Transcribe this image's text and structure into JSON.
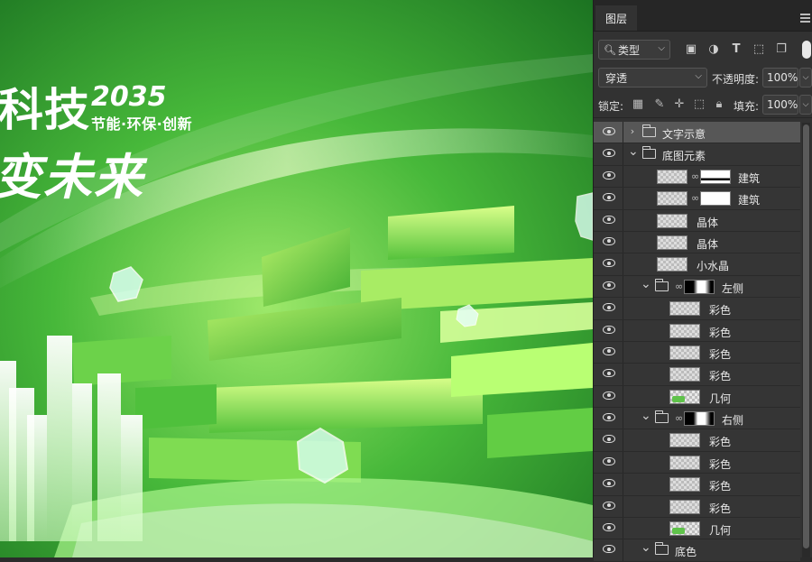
{
  "canvas": {
    "title_line1": "科技",
    "year": "2035",
    "slogan": "节能·环保·创新",
    "title_line2": "变未来"
  },
  "panel": {
    "tab_label": "图层",
    "filter": {
      "label": "类型",
      "search_icon": "search-icon"
    },
    "filter_icons": [
      "image-filter-icon",
      "adjustment-filter-icon",
      "type-filter-icon",
      "shape-filter-icon",
      "smart-object-filter-icon"
    ],
    "blend_mode": "穿透",
    "opacity_label": "不透明度:",
    "opacity_value": "100%",
    "lock_label": "锁定:",
    "fill_label": "填充:",
    "fill_value": "100%",
    "layers": [
      {
        "name": "文字示意",
        "kind": "group",
        "indent": 0,
        "expanded": false,
        "selected": true
      },
      {
        "name": "底图元素",
        "kind": "group",
        "indent": 0,
        "expanded": true
      },
      {
        "name": "建筑",
        "kind": "layer-mask",
        "indent": 1,
        "mask": "bld"
      },
      {
        "name": "建筑",
        "kind": "layer-mask",
        "indent": 1,
        "mask": "white"
      },
      {
        "name": "晶体",
        "kind": "layer",
        "indent": 1
      },
      {
        "name": "晶体",
        "kind": "layer",
        "indent": 1
      },
      {
        "name": "小水晶",
        "kind": "layer",
        "indent": 1
      },
      {
        "name": "左侧",
        "kind": "group-mask",
        "indent": 1,
        "expanded": true
      },
      {
        "name": "彩色",
        "kind": "layer",
        "indent": 2
      },
      {
        "name": "彩色",
        "kind": "layer",
        "indent": 2
      },
      {
        "name": "彩色",
        "kind": "layer",
        "indent": 2
      },
      {
        "name": "彩色",
        "kind": "layer",
        "indent": 2
      },
      {
        "name": "几何",
        "kind": "layer-green",
        "indent": 2
      },
      {
        "name": "右侧",
        "kind": "group-mask",
        "indent": 1,
        "expanded": true
      },
      {
        "name": "彩色",
        "kind": "layer",
        "indent": 2
      },
      {
        "name": "彩色",
        "kind": "layer",
        "indent": 2
      },
      {
        "name": "彩色",
        "kind": "layer",
        "indent": 2
      },
      {
        "name": "彩色",
        "kind": "layer",
        "indent": 2
      },
      {
        "name": "几何",
        "kind": "layer-green",
        "indent": 2
      },
      {
        "name": "底色",
        "kind": "group",
        "indent": 1,
        "expanded": true
      }
    ]
  },
  "colors": {
    "canvas_green": "#3fbf3a",
    "panel_bg": "#323232",
    "selected_row": "#575757"
  }
}
